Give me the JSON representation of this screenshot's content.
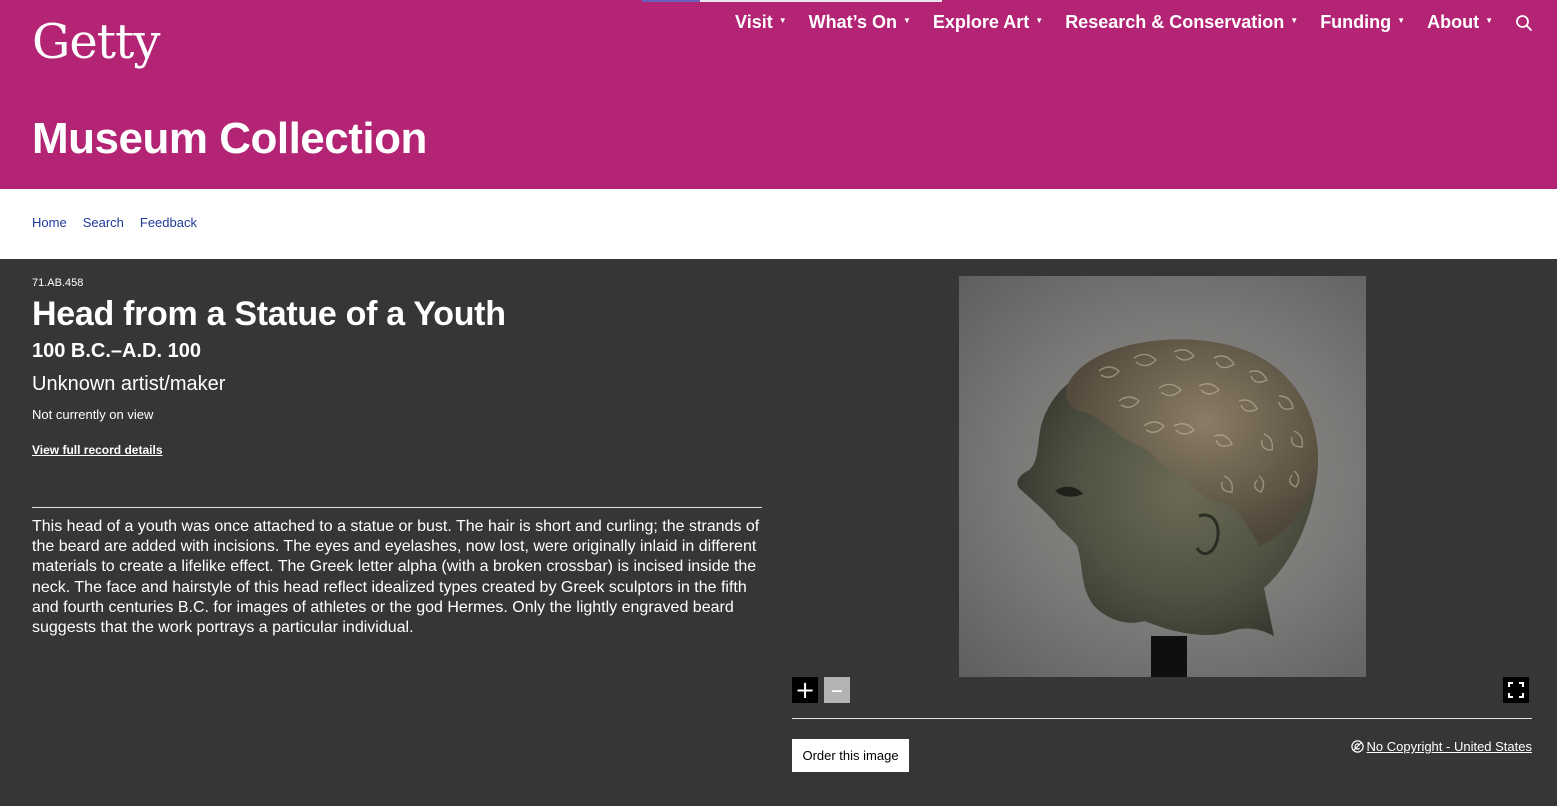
{
  "header": {
    "logo": "Getty",
    "nav": [
      {
        "label": "Visit"
      },
      {
        "label": "What’s On"
      },
      {
        "label": "Explore Art"
      },
      {
        "label": "Research & Conservation"
      },
      {
        "label": "Funding"
      },
      {
        "label": "About"
      }
    ],
    "search_icon": "search-icon",
    "page_title": "Museum Collection",
    "color": "#b32474"
  },
  "breadcrumb": [
    "Home",
    "Search",
    "Feedback"
  ],
  "object": {
    "accession": "71.AB.458",
    "title": "Head from a Statue of a Youth",
    "date": "100 B.C.–A.D. 100",
    "artist": "Unknown artist/maker",
    "view_status": "Not currently on view",
    "record_link": "View full record details",
    "description": "This head of a youth was once attached to a statue or bust. The hair is short and curling; the strands of the beard are added with incisions. The eyes and eyelashes, now lost, were originally inlaid in different materials to create a lifelike effect. The Greek letter alpha (with a broken crossbar) is incised inside the neck. The face and hairstyle of this head reflect idealized types created by Greek sculptors in the fifth and fourth centuries B.C. for images of athletes or the god Hermes. Only the lightly engraved beard suggests that the work portrays a particular individual."
  },
  "viewer": {
    "zoom_in": "+",
    "zoom_out": "–",
    "fullscreen_icon": "fullscreen-icon",
    "order_button": "Order this image",
    "rights_label": "No Copyright - United States",
    "rights_icon": "no-copyright-icon"
  },
  "colors": {
    "brand": "#b32474",
    "background": "#373634",
    "link": "#1f3b9a"
  }
}
